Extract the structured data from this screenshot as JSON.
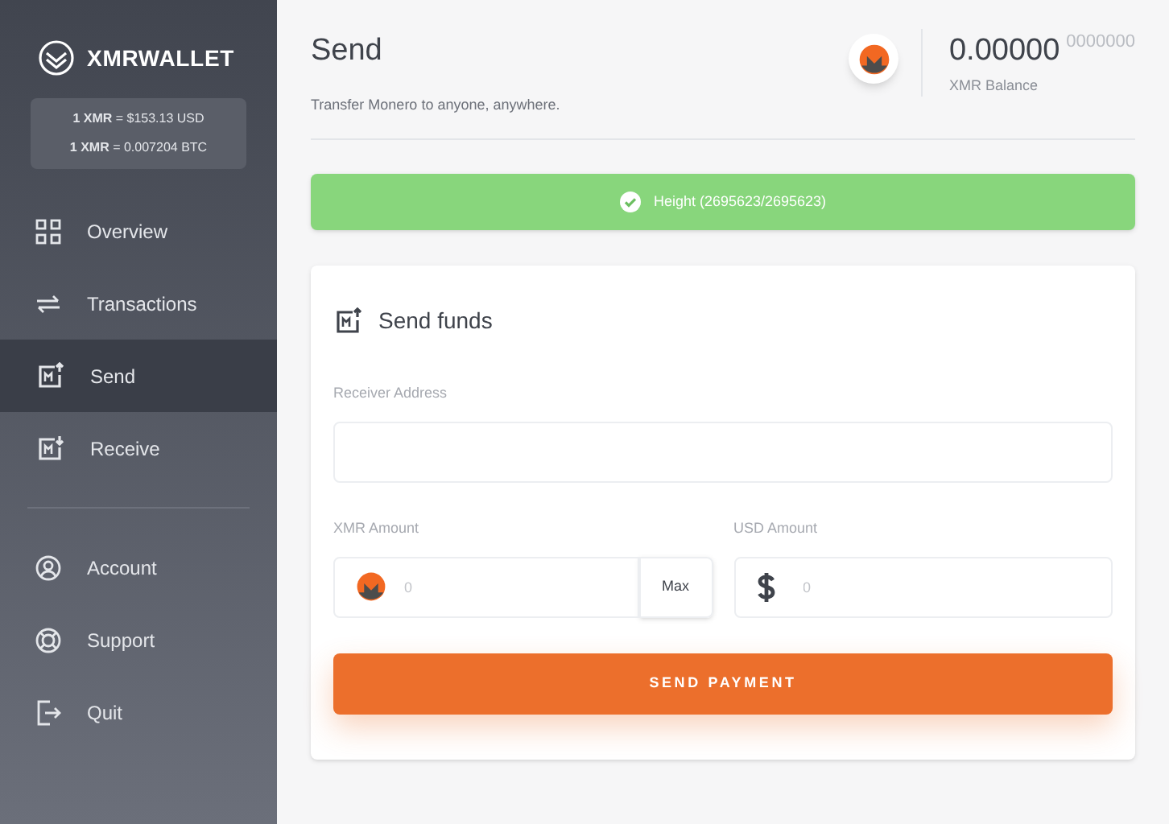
{
  "brand": {
    "name": "XMRWALLET"
  },
  "rates": [
    "**1 XMR** = $153.13 USD",
    "**1 XMR** = 0.007204 BTC"
  ],
  "nav": [
    {
      "kind": "grid",
      "label": "Overview",
      "selected": false
    },
    {
      "kind": "arrows",
      "label": "Transactions",
      "selected": false
    },
    {
      "kind": "send",
      "label": "Send",
      "selected": true
    },
    {
      "kind": "receive",
      "label": "Receive",
      "selected": false
    }
  ],
  "secondary_nav": [
    {
      "kind": "user",
      "label": "Account",
      "selected": false
    },
    {
      "kind": "lifebuoy",
      "label": "Support",
      "selected": false
    },
    {
      "kind": "exit",
      "label": "Quit",
      "selected": false
    }
  ],
  "header": {
    "title": "Send",
    "subtitle": "Transfer Monero to anyone, anywhere.",
    "balance": "0.00000",
    "balance_fraction": "0000000",
    "balance_label": "XMR Balance"
  },
  "status": {
    "text": "Height (2695623/2695623)",
    "synced": true
  },
  "form": {
    "title": "Send funds",
    "receiver_label": "Receiver Address",
    "xmr_label": "XMR Amount",
    "xmr_placeholder": "0",
    "max_button": "Max",
    "usd_label": "USD Amount",
    "usd_placeholder": "0",
    "submit": "SEND PAYMENT"
  }
}
